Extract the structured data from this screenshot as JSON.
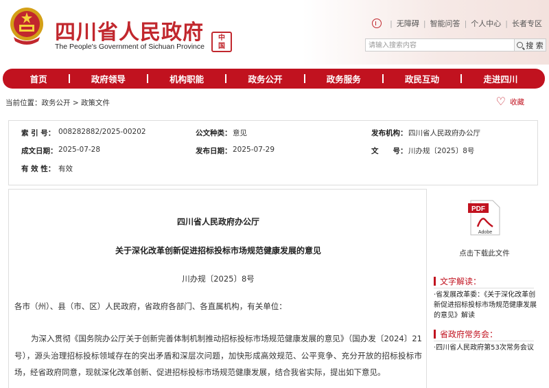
{
  "header": {
    "title_cn": "四川省人民政府",
    "title_en": "The People's Government of Sichuan Province",
    "seal_text": [
      "中",
      "国"
    ],
    "links": [
      "无障碍",
      "智能问答",
      "个人中心",
      "长者专区"
    ],
    "search": {
      "placeholder": "请输入搜索内容",
      "button": "搜 索"
    }
  },
  "nav": {
    "items": [
      "首页",
      "政府领导",
      "机构职能",
      "政务公开",
      "政务服务",
      "政民互动",
      "走进四川"
    ]
  },
  "breadcrumb": "当前位置：政务公开 > 政策文件",
  "favorite_label": "收藏",
  "meta": {
    "index_label": "索 引 号：",
    "index_value": "008282882/2025-00202",
    "type_label": "公文种类：",
    "type_value": "意见",
    "issuer_label": "发布机构：",
    "issuer_value": "四川省人民政府办公厅",
    "written_label": "成文日期：",
    "written_value": "2025-07-28",
    "published_label": "发布日期：",
    "published_value": "2025-07-29",
    "docno_label": "文　　号：",
    "docno_value": "川办规〔2025〕8号",
    "validity_label": "有 效 性：",
    "validity_value": "有效"
  },
  "article": {
    "org": "四川省人民政府办公厅",
    "title": "关于深化改革创新促进招标投标市场规范健康发展的意见",
    "doc_no": "川办规〔2025〕8号",
    "salutation": "各市（州）、县（市、区）人民政府，省政府各部门、各直属机构，有关单位：",
    "body": "为深入贯彻《国务院办公厅关于创新完善体制机制推动招标投标市场规范健康发展的意见》（国办发〔2024〕21号），源头治理招标投标领域存在的突出矛盾和深层次问题，加快形成高效规范、公平竞争、充分开放的招标投标市场，经省政府同意，现就深化改革创新、促进招标投标市场规范健康发展，结合我省实际，提出如下意见。"
  },
  "sidebar": {
    "download_label": "点击下载此文件",
    "pdf_text": "PDF",
    "adobe_text": "Adobe",
    "interpret_head": "文字解读：",
    "interpret_text": "·省发展改革委：《关于深化改革创新促进招标投标市场规范健康发展的意见》解读",
    "meeting_head": "省政府常务会：",
    "meeting_text": "·四川省人民政府第53次常务会议"
  },
  "colors": {
    "brand_red": "#c1121f",
    "title_red": "#c1272d"
  }
}
